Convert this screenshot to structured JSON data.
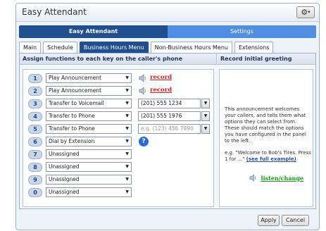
{
  "app": {
    "title": "Easy Attendant"
  },
  "header": {
    "gear_label": "⚙",
    "gear_caret": "▾"
  },
  "modes": [
    {
      "label": "Easy Attendant",
      "active": true
    },
    {
      "label": "Settings",
      "active": false
    }
  ],
  "tabs": [
    {
      "label": "Main",
      "active": false
    },
    {
      "label": "Schedule",
      "active": false
    },
    {
      "label": "Business Hours Menu",
      "active": true
    },
    {
      "label": "Non-Business Hours Menu",
      "active": false
    },
    {
      "label": "Extensions",
      "active": false
    }
  ],
  "left_header": "Assign functions to each key on the caller's phone",
  "right_header": "Record initial greeting",
  "keys": [
    {
      "key": "1",
      "action": "Play Announcement",
      "extra": "record"
    },
    {
      "key": "2",
      "action": "Play Announcement",
      "extra": "record"
    },
    {
      "key": "3",
      "action": "Transfer to Voicemail",
      "phone": "(201) 555 1234"
    },
    {
      "key": "4",
      "action": "Transfer to Phone",
      "phone": "(201) 555 1976"
    },
    {
      "key": "5",
      "action": "Transfer to Phone",
      "phone_placeholder": "e.g. (123) 456 7890"
    },
    {
      "key": "6",
      "action": "Dial by Extension",
      "help": "?"
    },
    {
      "key": "7",
      "action": "Unassigned"
    },
    {
      "key": "8",
      "action": "Unassigned"
    },
    {
      "key": "9",
      "action": "Unassigned"
    },
    {
      "key": "0",
      "action": "Unassigned"
    }
  ],
  "greeting": {
    "description": "This announcement welcomes your callers, and tells them what options they can select from. These should match the options you have configured in the panel to the left.",
    "example_prefix": "e.g. \"Welcome to Bob's Tires. Press 1 for ...\"",
    "example_link": "(see full example)",
    "listen_label": "listen/change"
  },
  "footer": {
    "apply_label": "Apply",
    "cancel_label": "Cancel"
  }
}
